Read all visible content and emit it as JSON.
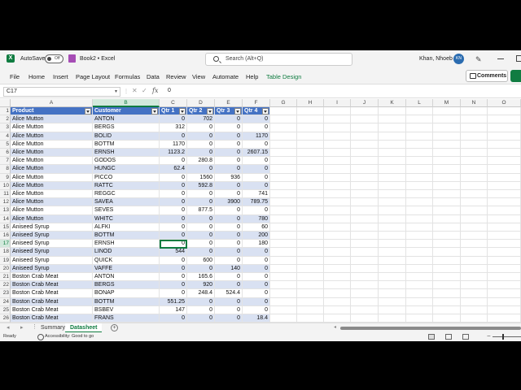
{
  "titlebar": {
    "autosave_label": "AutoSave",
    "autosave_state": "Off",
    "book_name": "Book2",
    "app_name": "Excel",
    "search_placeholder": "Search (Alt+Q)",
    "user_name": "Khan, Nhoeb",
    "avatar_initials": "KN"
  },
  "ribbon": {
    "tabs": [
      "File",
      "Home",
      "Insert",
      "Page Layout",
      "Formulas",
      "Data",
      "Review",
      "View",
      "Automate",
      "Help",
      "Table Design"
    ],
    "comments_label": "Comments"
  },
  "formula_bar": {
    "name_box": "C17",
    "value": "0"
  },
  "grid": {
    "columns": [
      "A",
      "B",
      "C",
      "D",
      "E",
      "F",
      "G",
      "H",
      "I",
      "J",
      "K",
      "L",
      "M",
      "N",
      "O"
    ],
    "selected_column": "B",
    "active_cell": "C17",
    "table_headers": [
      "Product",
      "Customer",
      "Qtr 1",
      "Qtr 2",
      "Qtr 3",
      "Qtr 4"
    ],
    "rows": [
      [
        "Alice Mutton",
        "ANTON",
        "0",
        "702",
        "0",
        "0"
      ],
      [
        "Alice Mutton",
        "BERGS",
        "312",
        "0",
        "0",
        "0"
      ],
      [
        "Alice Mutton",
        "BOLID",
        "0",
        "0",
        "0",
        "1170"
      ],
      [
        "Alice Mutton",
        "BOTTM",
        "1170",
        "0",
        "0",
        "0"
      ],
      [
        "Alice Mutton",
        "ERNSH",
        "1123.2",
        "0",
        "0",
        "2607.15"
      ],
      [
        "Alice Mutton",
        "GODOS",
        "0",
        "280.8",
        "0",
        "0"
      ],
      [
        "Alice Mutton",
        "HUNGC",
        "62.4",
        "0",
        "0",
        "0"
      ],
      [
        "Alice Mutton",
        "PICCO",
        "0",
        "1560",
        "936",
        "0"
      ],
      [
        "Alice Mutton",
        "RATTC",
        "0",
        "592.8",
        "0",
        "0"
      ],
      [
        "Alice Mutton",
        "REGGC",
        "0",
        "0",
        "0",
        "741"
      ],
      [
        "Alice Mutton",
        "SAVEA",
        "0",
        "0",
        "3900",
        "789.75"
      ],
      [
        "Alice Mutton",
        "SEVES",
        "0",
        "877.5",
        "0",
        "0"
      ],
      [
        "Alice Mutton",
        "WHITC",
        "0",
        "0",
        "0",
        "780"
      ],
      [
        "Aniseed Syrup",
        "ALFKI",
        "0",
        "0",
        "0",
        "60"
      ],
      [
        "Aniseed Syrup",
        "BOTTM",
        "0",
        "0",
        "0",
        "200"
      ],
      [
        "Aniseed Syrup",
        "ERNSH",
        "0",
        "0",
        "0",
        "180"
      ],
      [
        "Aniseed Syrup",
        "LINOD",
        "544",
        "0",
        "0",
        "0"
      ],
      [
        "Aniseed Syrup",
        "QUICK",
        "0",
        "600",
        "0",
        "0"
      ],
      [
        "Aniseed Syrup",
        "VAFFE",
        "0",
        "0",
        "140",
        "0"
      ],
      [
        "Boston Crab Meat",
        "ANTON",
        "0",
        "165.6",
        "0",
        "0"
      ],
      [
        "Boston Crab Meat",
        "BERGS",
        "0",
        "920",
        "0",
        "0"
      ],
      [
        "Boston Crab Meat",
        "BONAP",
        "0",
        "248.4",
        "524.4",
        "0"
      ],
      [
        "Boston Crab Meat",
        "BOTTM",
        "551.25",
        "0",
        "0",
        "0"
      ],
      [
        "Boston Crab Meat",
        "BSBEV",
        "147",
        "0",
        "0",
        "0"
      ],
      [
        "Boston Crab Meat",
        "FRANS",
        "0",
        "0",
        "0",
        "18.4"
      ]
    ]
  },
  "sheets": {
    "tabs": [
      "Summary",
      "Datasheet"
    ],
    "active": "Datasheet"
  },
  "statusbar": {
    "ready": "Ready",
    "accessibility": "Accessibility: Good to go"
  },
  "colors": {
    "excel_green": "#107c41",
    "table_header": "#4472c4",
    "table_band": "#d9e1f2"
  }
}
